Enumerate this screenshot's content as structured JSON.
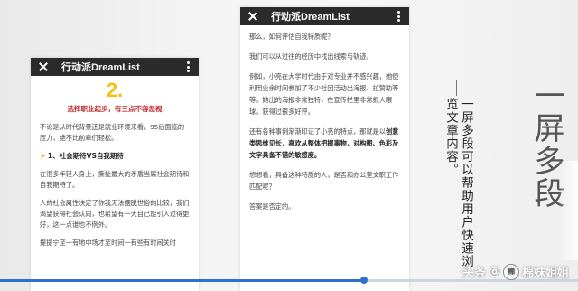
{
  "left_phone": {
    "app_title": "行动派DreamList",
    "section_number": "2.",
    "red_title": "选择职业起步，有三点不容忽视",
    "paragraphs": [
      "不论是从时代背景还是就业环境来看，95后面临的压力，绝不比前辈们轻松。",
      "在很多年轻人身上，撕扯最大的矛盾当属社会期待和自我期待了。",
      "人的社会属性决定了你我无法摆脱世俗的比较，我们渴望获得社会认同，也希望有一天自己能引人过得更好，这一点谁也不例外。"
    ],
    "subhead_arrow": "➤",
    "subhead": "1、社会期待VS自我期待",
    "cut_line": "提提宁至一有地中场才至时间一有些有时间关时"
  },
  "right_phone": {
    "app_title": "行动派DreamList",
    "paragraphs": [
      "那么，如何评估自我特质呢？",
      "我们可以从过往的经历中找出线索与轨迹。",
      "例如，小亮在大学时代由于对专业并不感兴趣，她便利用业余时间参加了不少社团活动出海报、拉赞助等等，她出的海报非常独特，在宣传栏里非常抓人眼球，获得过很多好评。",
      "想想看，具备这种特质的人，是否和办公室文职工作匹配呢？",
      "答案是否定的。"
    ],
    "bold_para_prefix": "还有各种事例渐渐印证了小亮的特点，那就是以",
    "bold_para_bold": "创意类思维见长，喜欢从整体把握事物，对构图、色彩及文字具备不错的敏感度。"
  },
  "overlay": {
    "vertical_caption": "一屏多段可以帮助用户快速浏览文章内容。",
    "big_title": "一屏多段"
  },
  "progress": {
    "value": 0.63
  },
  "watermark": {
    "prefix": "头条",
    "at": "@",
    "name": "棉妹姐姐",
    "logo_char": "棉"
  },
  "colors": {
    "accent_yellow": "#f2c10f",
    "red": "#c0282d",
    "progress": "#2f6fd0",
    "bar": "#2b2b2b"
  }
}
